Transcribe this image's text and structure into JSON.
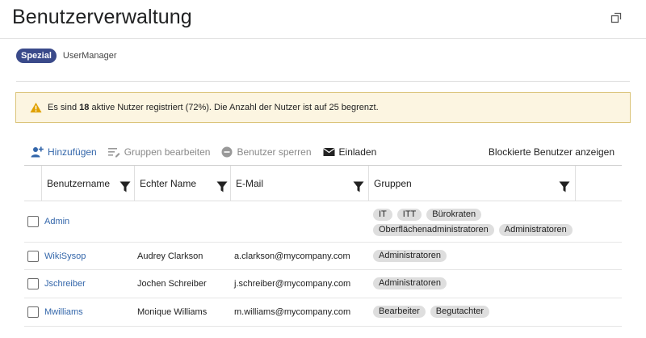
{
  "header": {
    "title": "Benutzerverwaltung",
    "collapse_icon": "collapse-icon"
  },
  "breadcrumb": {
    "badge": "Spezial",
    "page": "UserManager"
  },
  "notice": {
    "icon": "warning-icon",
    "pre": "Es sind ",
    "count": "18",
    "post": " aktive Nutzer registriert (72%). Die Anzahl der Nutzer ist auf 25 begrenzt."
  },
  "toolbar": {
    "add_label": "Hinzufügen",
    "edit_groups_label": "Gruppen bearbeiten",
    "block_label": "Benutzer sperren",
    "invite_label": "Einladen",
    "blocked_label": "Blockierte Benutzer anzeigen"
  },
  "table": {
    "columns": {
      "username": "Benutzername",
      "realname": "Echter Name",
      "email": "E-Mail",
      "groups": "Gruppen"
    },
    "rows": [
      {
        "username": "Admin",
        "realname": "",
        "email": "",
        "groups": [
          "IT",
          "ITT",
          "Bürokraten",
          "Oberflächenadministratoren",
          "Administratoren"
        ]
      },
      {
        "username": "WikiSysop",
        "realname": "Audrey Clarkson",
        "email": "a.clarkson@mycompany.com",
        "groups": [
          "Administratoren"
        ]
      },
      {
        "username": "Jschreiber",
        "realname": "Jochen Schreiber",
        "email": "j.schreiber@mycompany.com",
        "groups": [
          "Administratoren"
        ]
      },
      {
        "username": "Mwilliams",
        "realname": "Monique Williams",
        "email": "m.williams@mycompany.com",
        "groups": [
          "Bearbeiter",
          "Begutachter"
        ]
      }
    ]
  },
  "colors": {
    "accent": "#3366aa",
    "badge": "#3a4a8a",
    "notice_bg": "#fcf5e1",
    "notice_border": "#dbc47a",
    "warning": "#e0a100"
  }
}
